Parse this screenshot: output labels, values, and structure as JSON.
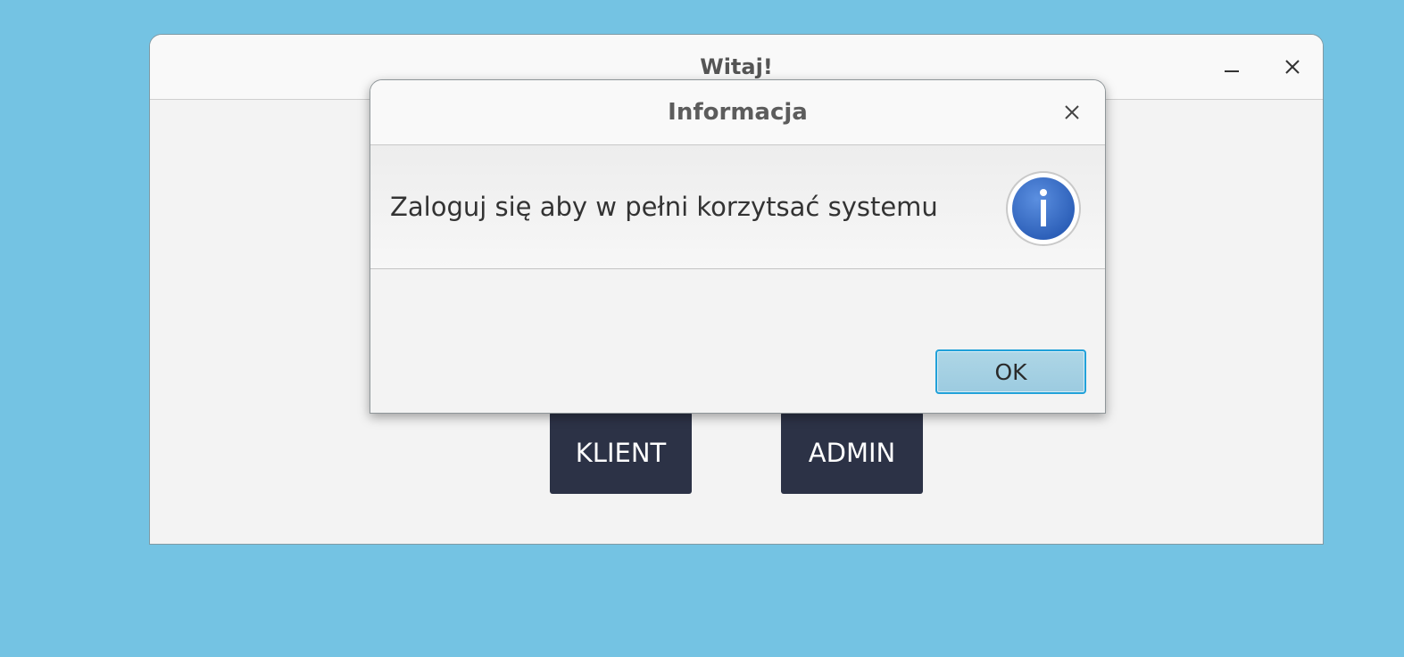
{
  "main_window": {
    "title": "Witaj!",
    "buttons": {
      "klient_label": "KLIENT",
      "admin_label": "ADMIN"
    },
    "controls": {
      "minimize_icon": "minimize-icon",
      "close_icon": "close-icon"
    }
  },
  "dialog": {
    "title": "Informacja",
    "message": "Zaloguj się aby w pełni korzytsać systemu",
    "icon": "info-icon",
    "ok_label": "OK",
    "close_icon": "close-icon"
  },
  "colors": {
    "desktop_background": "#74c3e3",
    "primary_button": "#2c3246",
    "ok_button": "#a8d3e5",
    "ok_border": "#21a1d9",
    "info_icon": "#3d6fc8"
  }
}
